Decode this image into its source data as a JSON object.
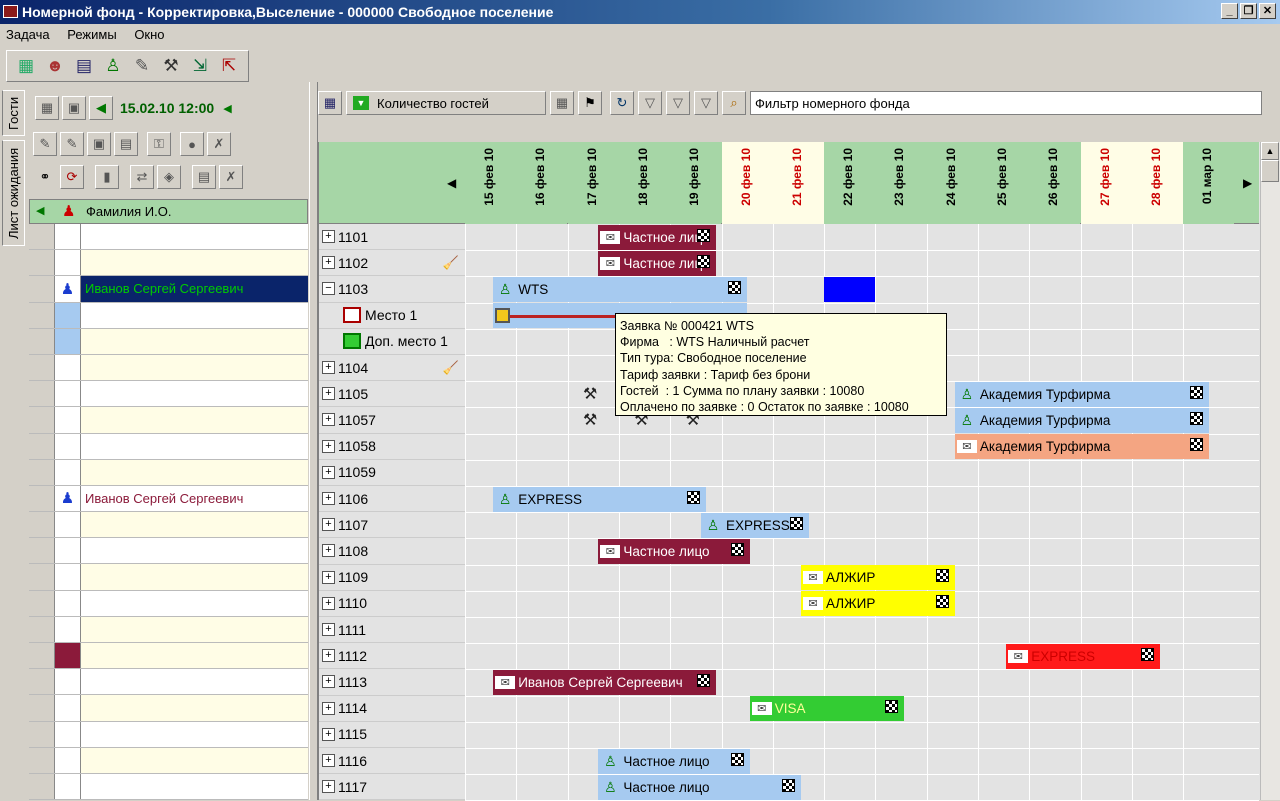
{
  "window": {
    "title": "Номерной фонд - Корректировка,Выселение - 000000 Свободное поселение"
  },
  "menu": [
    "Задача",
    "Режимы",
    "Окно"
  ],
  "side_tabs": [
    "Гости",
    "Лист ожидания"
  ],
  "left": {
    "datetime": "15.02.10 12:00",
    "column_header": "Фамилия И.О.",
    "rows": [
      {
        "name": "",
        "c2": "#ffffff",
        "bg": "#ffffff"
      },
      {
        "name": "",
        "c2": "#ffffff",
        "bg": "#fffde6"
      },
      {
        "name": "Иванов Сергей Сергеевич",
        "c2": "#ffffff",
        "bg": "#0a246a",
        "color": "#00cc00",
        "icon": "person-icon"
      },
      {
        "name": "",
        "c2": "#a6caf0",
        "bg": "#ffffff"
      },
      {
        "name": "",
        "c2": "#a6caf0",
        "bg": "#fffde6"
      },
      {
        "name": "",
        "c2": "#ffffff",
        "bg": "#fffde6"
      },
      {
        "name": "",
        "c2": "#ffffff",
        "bg": "#ffffff"
      },
      {
        "name": "",
        "c2": "#ffffff",
        "bg": "#fffde6"
      },
      {
        "name": "",
        "c2": "#ffffff",
        "bg": "#ffffff"
      },
      {
        "name": "",
        "c2": "#ffffff",
        "bg": "#fffde6"
      },
      {
        "name": "Иванов Сергей Сергеевич",
        "c2": "#ffffff",
        "bg": "#ffffff",
        "color": "#8b1a3a",
        "icon": "person-icon"
      },
      {
        "name": "",
        "c2": "#ffffff",
        "bg": "#fffde6"
      },
      {
        "name": "",
        "c2": "#ffffff",
        "bg": "#ffffff"
      },
      {
        "name": "",
        "c2": "#ffffff",
        "bg": "#fffde6"
      },
      {
        "name": "",
        "c2": "#ffffff",
        "bg": "#ffffff"
      },
      {
        "name": "",
        "c2": "#ffffff",
        "bg": "#fffde6"
      },
      {
        "name": "",
        "c2": "#8b1a3a",
        "bg": "#fffde6"
      },
      {
        "name": "",
        "c2": "#ffffff",
        "bg": "#ffffff"
      },
      {
        "name": "",
        "c2": "#ffffff",
        "bg": "#fffde6"
      },
      {
        "name": "",
        "c2": "#ffffff",
        "bg": "#ffffff"
      },
      {
        "name": "",
        "c2": "#ffffff",
        "bg": "#fffde6"
      },
      {
        "name": "",
        "c2": "#ffffff",
        "bg": "#ffffff"
      }
    ]
  },
  "right_toolbar": {
    "guests_combo": "Количество гостей",
    "filter_text": "Фильтр номерного фонда"
  },
  "dates": [
    {
      "label": "15 фев 10",
      "weekend": false
    },
    {
      "label": "16 фев 10",
      "weekend": false
    },
    {
      "label": "17 фев 10",
      "weekend": false
    },
    {
      "label": "18 фев 10",
      "weekend": false
    },
    {
      "label": "19 фев 10",
      "weekend": false
    },
    {
      "label": "20 фев 10",
      "weekend": true
    },
    {
      "label": "21 фев 10",
      "weekend": true
    },
    {
      "label": "22 фев 10",
      "weekend": false
    },
    {
      "label": "23 фев 10",
      "weekend": false
    },
    {
      "label": "24 фев 10",
      "weekend": false
    },
    {
      "label": "25 фев 10",
      "weekend": false
    },
    {
      "label": "26 фев 10",
      "weekend": false
    },
    {
      "label": "27 фев 10",
      "weekend": true
    },
    {
      "label": "28 фев 10",
      "weekend": true
    },
    {
      "label": "01 мар 10",
      "weekend": false
    }
  ],
  "rooms": [
    {
      "label": "1101",
      "type": "room"
    },
    {
      "label": "1102",
      "type": "room",
      "extra": "broom-icon"
    },
    {
      "label": "1103",
      "type": "room-open"
    },
    {
      "label": "Место 1",
      "type": "bed"
    },
    {
      "label": "Доп. место 1",
      "type": "extra-bed"
    },
    {
      "label": "1104",
      "type": "room",
      "extra": "broom-icon"
    },
    {
      "label": "1105",
      "type": "room"
    },
    {
      "label": "11057",
      "type": "room"
    },
    {
      "label": "11058",
      "type": "room"
    },
    {
      "label": "11059",
      "type": "room"
    },
    {
      "label": "1106",
      "type": "room"
    },
    {
      "label": "1107",
      "type": "room"
    },
    {
      "label": "1108",
      "type": "room"
    },
    {
      "label": "1109",
      "type": "room"
    },
    {
      "label": "1110",
      "type": "room"
    },
    {
      "label": "1111",
      "type": "room"
    },
    {
      "label": "1112",
      "type": "room"
    },
    {
      "label": "1113",
      "type": "room"
    },
    {
      "label": "1114",
      "type": "room"
    },
    {
      "label": "1115",
      "type": "room"
    },
    {
      "label": "1116",
      "type": "room"
    },
    {
      "label": "1117",
      "type": "room"
    }
  ],
  "bookings": [
    {
      "row": 0,
      "start": 2.6,
      "end": 4.9,
      "text": "Частное лицо",
      "bg": "#8b1a3a",
      "fg": "#ffffff",
      "icon": "handshake-icon"
    },
    {
      "row": 1,
      "start": 2.6,
      "end": 4.9,
      "text": "Частное лицо",
      "bg": "#8b1a3a",
      "fg": "#ffffff",
      "icon": "handshake-icon"
    },
    {
      "row": 2,
      "start": 0.55,
      "end": 5.5,
      "text": "WTS",
      "bg": "#a6caf0",
      "fg": "#000000",
      "icon": "person-icon"
    },
    {
      "row": 3,
      "start": 0.55,
      "end": 5.5,
      "text": "",
      "bg": "#a6caf0",
      "fg": "#000000",
      "icon": "",
      "noflag": true
    },
    {
      "row": 2,
      "start": 7.0,
      "end": 8.0,
      "text": "",
      "bg": "#0000ff",
      "fg": "#ffffff",
      "icon": "",
      "noflag": true
    },
    {
      "row": 6,
      "start": 9.55,
      "end": 14.5,
      "text": "Академия Турфирма",
      "bg": "#a6caf0",
      "fg": "#000000",
      "icon": "person-icon"
    },
    {
      "row": 7,
      "start": 9.55,
      "end": 14.5,
      "text": "Академия Турфирма",
      "bg": "#a6caf0",
      "fg": "#000000",
      "icon": "person-icon"
    },
    {
      "row": 8,
      "start": 9.55,
      "end": 14.5,
      "text": "Академия Турфирма",
      "bg": "#f4a582",
      "fg": "#000000",
      "icon": "handshake-icon"
    },
    {
      "row": 10,
      "start": 0.55,
      "end": 4.7,
      "text": "EXPRESS",
      "bg": "#a6caf0",
      "fg": "#000000",
      "icon": "person-icon"
    },
    {
      "row": 11,
      "start": 4.6,
      "end": 6.7,
      "text": "EXPRESS",
      "bg": "#a6caf0",
      "fg": "#000000",
      "icon": "person-icon"
    },
    {
      "row": 12,
      "start": 2.6,
      "end": 5.55,
      "text": "Частное лицо",
      "bg": "#8b1a3a",
      "fg": "#ffffff",
      "icon": "handshake-icon"
    },
    {
      "row": 13,
      "start": 6.55,
      "end": 9.55,
      "text": "АЛЖИР",
      "bg": "#ffff00",
      "fg": "#000000",
      "icon": "handshake-icon"
    },
    {
      "row": 14,
      "start": 6.55,
      "end": 9.55,
      "text": "АЛЖИР",
      "bg": "#ffff00",
      "fg": "#000000",
      "icon": "handshake-icon"
    },
    {
      "row": 16,
      "start": 10.55,
      "end": 13.55,
      "text": "EXPRESS",
      "bg": "#ff1a1a",
      "fg": "#cc0000",
      "icon": "handshake-icon"
    },
    {
      "row": 17,
      "start": 0.55,
      "end": 4.9,
      "text": "Иванов Сергей Сергеевич",
      "bg": "#8b1a3a",
      "fg": "#ffffff",
      "icon": "handshake-icon"
    },
    {
      "row": 18,
      "start": 5.55,
      "end": 8.55,
      "text": "VISA",
      "bg": "#33cc33",
      "fg": "#ffff99",
      "icon": "handshake-icon"
    },
    {
      "row": 20,
      "start": 2.6,
      "end": 5.55,
      "text": "Частное лицо",
      "bg": "#a6caf0",
      "fg": "#000000",
      "icon": "person-icon"
    },
    {
      "row": 21,
      "start": 2.6,
      "end": 6.55,
      "text": "Частное лицо",
      "bg": "#a6caf0",
      "fg": "#000000",
      "icon": "person-icon"
    }
  ],
  "tools_marks": [
    {
      "row": 6,
      "col": 2.3
    },
    {
      "row": 7,
      "col": 2.3
    },
    {
      "row": 7,
      "col": 3.3
    },
    {
      "row": 7,
      "col": 4.3
    }
  ],
  "tooltip": {
    "lines": [
      "Заявка № 000421 WTS",
      "Фирма   : WTS Наличный расчет",
      "Тип тура: Свободное поселение",
      "Тариф заявки : Тариф без брони",
      "Гостей  : 1 Сумма по плану заявки : 10080",
      "Оплачено по заявке : 0 Остаток по заявке : 10080"
    ]
  },
  "colors": {
    "header_green": "#a6d6a6",
    "weekend_red": "#cc0000",
    "weekend_bg": "#fffde6"
  }
}
